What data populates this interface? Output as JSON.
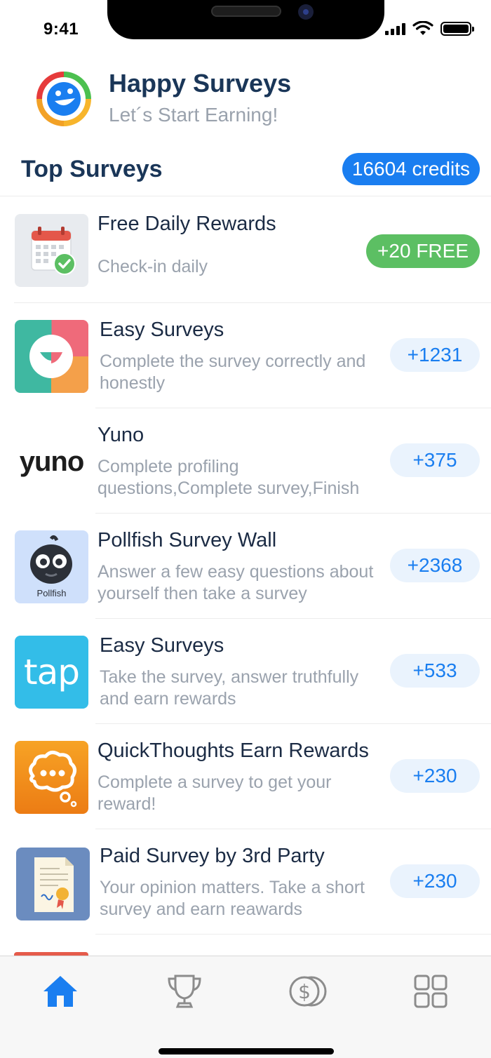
{
  "status_bar": {
    "time": "9:41"
  },
  "header": {
    "title": "Happy Surveys",
    "subtitle": "Let´s Start Earning!"
  },
  "section": {
    "title": "Top Surveys",
    "credits": "16604 credits"
  },
  "surveys": [
    {
      "title": "Free Daily Rewards",
      "description": "Check-in daily",
      "reward": "+20 FREE",
      "icon": "calendar-check-icon"
    },
    {
      "title": "Easy Surveys",
      "description": "Complete the survey correctly and honestly",
      "reward": "+1231",
      "icon": "smile-logo-icon"
    },
    {
      "title": "Yuno",
      "description": "Complete profiling questions,Complete survey,Finish",
      "reward": "+375",
      "icon": "yuno-logo"
    },
    {
      "title": "Pollfish Survey Wall",
      "description": "Answer a few easy questions about yourself then take a survey",
      "reward": "+2368",
      "icon": "pollfish-logo",
      "icon_label": "Pollfish"
    },
    {
      "title": "Easy Surveys",
      "description": "Take the survey, answer truthfully and earn rewards",
      "reward": "+533",
      "icon": "tap-logo",
      "icon_label": "tap"
    },
    {
      "title": "QuickThoughts   Earn Rewards",
      "description": "Complete a survey to get your reward!",
      "reward": "+230",
      "icon": "thought-bubble-icon"
    },
    {
      "title": "Paid Survey by 3rd Party",
      "description": "Your opinion matters. Take a short survey and earn reawards",
      "reward": "+230",
      "icon": "certificate-icon"
    }
  ],
  "yuno_wordmark": "yuno",
  "tabs": [
    {
      "name": "home",
      "active": true
    },
    {
      "name": "trophy",
      "active": false
    },
    {
      "name": "coins",
      "active": false
    },
    {
      "name": "grid",
      "active": false
    }
  ],
  "colors": {
    "accent": "#1a7ef0",
    "title": "#1a3658",
    "muted": "#9aa2ad",
    "free_green": "#5cbf63",
    "pill_bg": "#eaf3fd"
  }
}
